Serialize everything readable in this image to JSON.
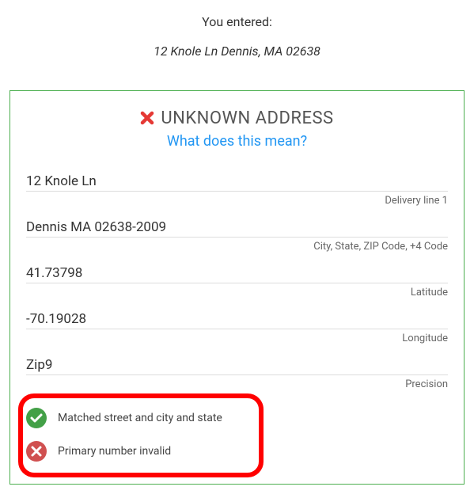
{
  "intro": {
    "label": "You entered:",
    "value": "12 Knole Ln Dennis, MA 02638"
  },
  "header": {
    "title": "UNKNOWN ADDRESS",
    "help_link": "What does this mean?"
  },
  "fields": [
    {
      "value": "12 Knole Ln",
      "label": "Delivery line 1"
    },
    {
      "value": "Dennis MA 02638-2009",
      "label": "City, State, ZIP Code, +4 Code"
    },
    {
      "value": "41.73798",
      "label": "Latitude"
    },
    {
      "value": "-70.19028",
      "label": "Longitude"
    },
    {
      "value": "Zip9",
      "label": "Precision"
    }
  ],
  "statuses": [
    {
      "ok": true,
      "text": "Matched street and city and state"
    },
    {
      "ok": false,
      "text": "Primary number invalid"
    }
  ]
}
